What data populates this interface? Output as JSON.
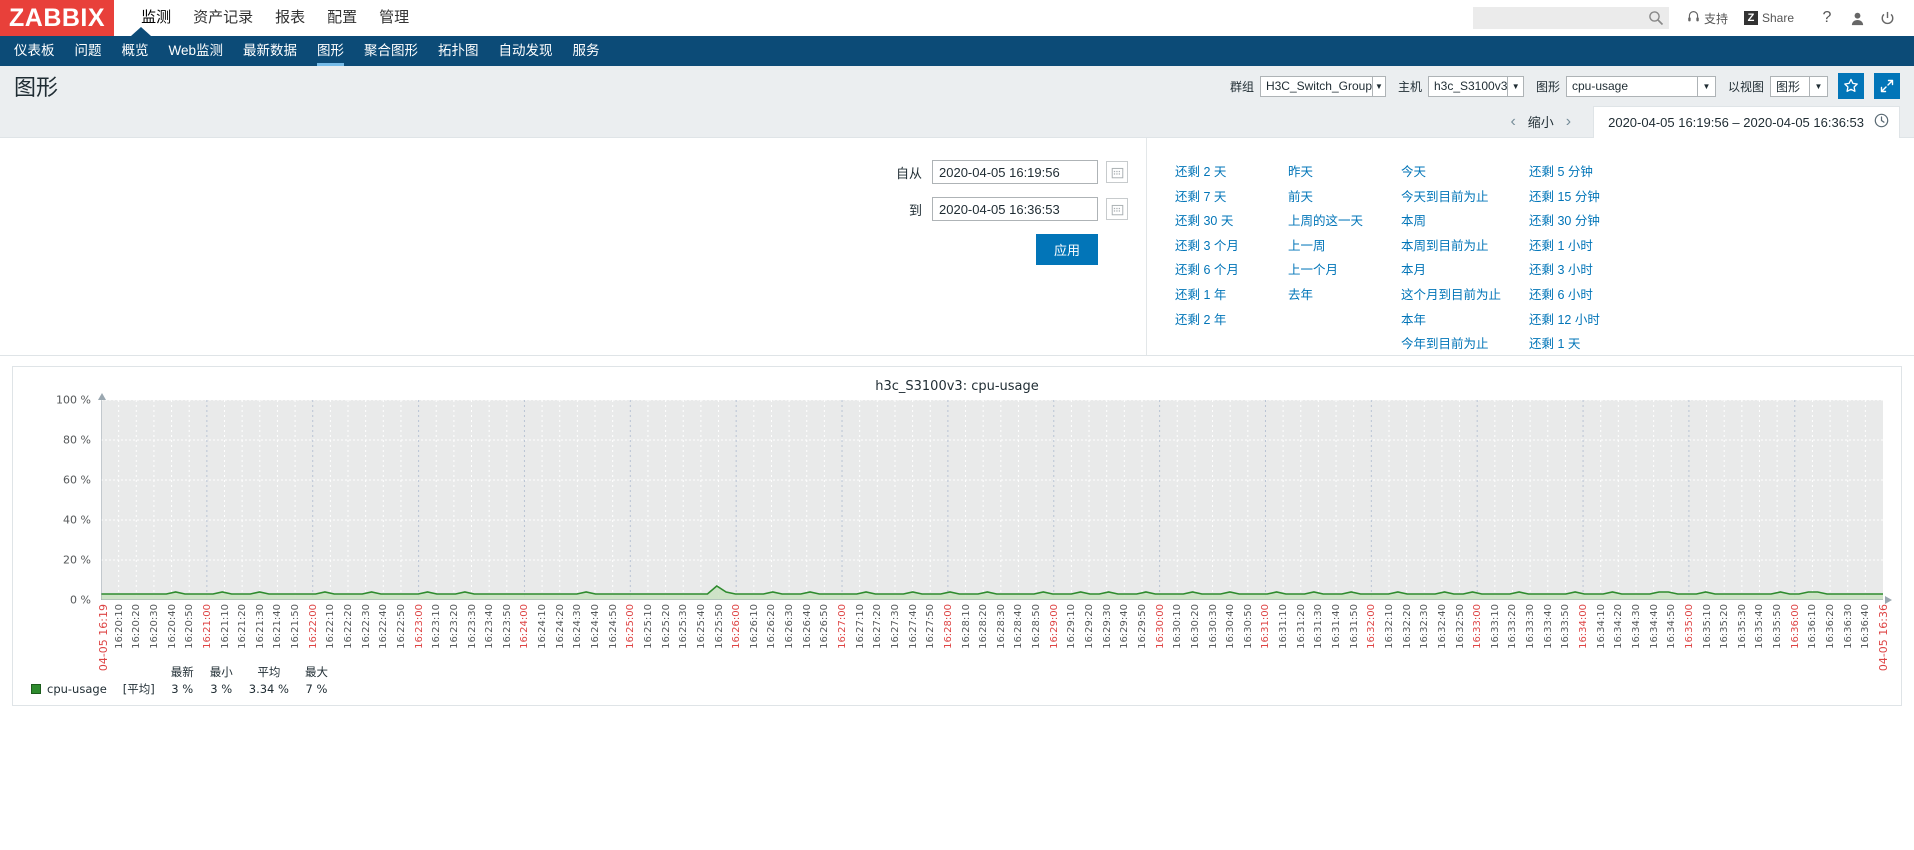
{
  "header": {
    "logo": "ZABBIX",
    "main_menu": [
      {
        "label": "监测",
        "selected": true
      },
      {
        "label": "资产记录",
        "selected": false
      },
      {
        "label": "报表",
        "selected": false
      },
      {
        "label": "配置",
        "selected": false
      },
      {
        "label": "管理",
        "selected": false
      }
    ],
    "search": {
      "value": "",
      "placeholder": ""
    },
    "search_icon": "search-icon",
    "support_label": "支持",
    "support_icon": "headset-icon",
    "share_label": "Share",
    "share_badge": "Z",
    "help_icon": "question-mark-icon",
    "user_icon": "user-icon",
    "logout_icon": "power-icon"
  },
  "sub_nav": [
    {
      "label": "仪表板",
      "active": false
    },
    {
      "label": "问题",
      "active": false
    },
    {
      "label": "概览",
      "active": false
    },
    {
      "label": "Web监测",
      "active": false
    },
    {
      "label": "最新数据",
      "active": false
    },
    {
      "label": "图形",
      "active": true
    },
    {
      "label": "聚合图形",
      "active": false
    },
    {
      "label": "拓扑图",
      "active": false
    },
    {
      "label": "自动发现",
      "active": false
    },
    {
      "label": "服务",
      "active": false
    }
  ],
  "page": {
    "title": "图形"
  },
  "filter": {
    "group_label": "群组",
    "group_value": "H3C_Switch_Group",
    "host_label": "主机",
    "host_value": "h3c_S3100v3",
    "graph_label": "图形",
    "graph_value": "cpu-usage",
    "view_label": "以视图",
    "view_value": "图形",
    "favorite_icon": "star-icon",
    "fullscreen_icon": "expand-icon"
  },
  "time_bar": {
    "prev_icon": "chevron-left-icon",
    "zoom_out_label": "缩小",
    "next_icon": "chevron-right-icon",
    "range_text": "2020-04-05 16:19:56 – 2020-04-05 16:36:53",
    "clock_icon": "clock-icon"
  },
  "time_panel": {
    "from_label": "自从",
    "from_value": "2020-04-05 16:19:56",
    "to_label": "到",
    "to_value": "2020-04-05 16:36:53",
    "calendar_icon": "calendar-icon",
    "apply_label": "应用",
    "quick_ranges": [
      [
        "还剩 2 天",
        "还剩 7 天",
        "还剩 30 天",
        "还剩 3 个月",
        "还剩 6 个月",
        "还剩 1 年",
        "还剩 2 年"
      ],
      [
        "昨天",
        "前天",
        "上周的这一天",
        "上一周",
        "上一个月",
        "去年"
      ],
      [
        "今天",
        "今天到目前为止",
        "本周",
        "本周到目前为止",
        "本月",
        "这个月到目前为止",
        "本年",
        "今年到目前为止"
      ],
      [
        "还剩 5 分钟",
        "还剩 15 分钟",
        "还剩 30 分钟",
        "还剩 1 小时",
        "还剩 3 小时",
        "还剩 6 小时",
        "还剩 12 小时",
        "还剩 1 天"
      ]
    ]
  },
  "chart_data": {
    "type": "area",
    "title": "h3c_S3100v3: cpu-usage",
    "xlabel": "",
    "ylabel": "",
    "ylim": [
      0,
      100
    ],
    "yticks": [
      0,
      20,
      40,
      60,
      80,
      100
    ],
    "ytick_labels": [
      "0 %",
      "20 %",
      "40 %",
      "60 %",
      "80 %",
      "100 %"
    ],
    "grid": true,
    "legend_position": "bottom-left",
    "series_color": "#2e8b2e",
    "fill_color": "#c9e2c1",
    "x_start": "2020-04-05 16:19:56",
    "x_end": "2020-04-05 16:36:53",
    "x_edge_labels": [
      "04-05 16:19",
      "04-05 16:36"
    ],
    "x_tick_interval_seconds": 10,
    "xtick_labels": [
      "16:20:10",
      "16:20:20",
      "16:20:30",
      "16:20:40",
      "16:20:50",
      "16:21:00",
      "16:21:10",
      "16:21:20",
      "16:21:30",
      "16:21:40",
      "16:21:50",
      "16:22:00",
      "16:22:10",
      "16:22:20",
      "16:22:30",
      "16:22:40",
      "16:22:50",
      "16:23:00",
      "16:23:10",
      "16:23:20",
      "16:23:30",
      "16:23:40",
      "16:23:50",
      "16:24:00",
      "16:24:10",
      "16:24:20",
      "16:24:30",
      "16:24:40",
      "16:24:50",
      "16:25:00",
      "16:25:10",
      "16:25:20",
      "16:25:30",
      "16:25:40",
      "16:25:50",
      "16:26:00",
      "16:26:10",
      "16:26:20",
      "16:26:30",
      "16:26:40",
      "16:26:50",
      "16:27:00",
      "16:27:10",
      "16:27:20",
      "16:27:30",
      "16:27:40",
      "16:27:50",
      "16:28:00",
      "16:28:10",
      "16:28:20",
      "16:28:30",
      "16:28:40",
      "16:28:50",
      "16:29:00",
      "16:29:10",
      "16:29:20",
      "16:29:30",
      "16:29:40",
      "16:29:50",
      "16:30:00",
      "16:30:10",
      "16:30:20",
      "16:30:30",
      "16:30:40",
      "16:30:50",
      "16:31:00",
      "16:31:10",
      "16:31:20",
      "16:31:30",
      "16:31:40",
      "16:31:50",
      "16:32:00",
      "16:32:10",
      "16:32:20",
      "16:32:30",
      "16:32:40",
      "16:32:50",
      "16:33:00",
      "16:33:10",
      "16:33:20",
      "16:33:30",
      "16:33:40",
      "16:33:50",
      "16:34:00",
      "16:34:10",
      "16:34:20",
      "16:34:30",
      "16:34:40",
      "16:34:50",
      "16:35:00",
      "16:35:10",
      "16:35:20",
      "16:35:30",
      "16:35:40",
      "16:35:50",
      "16:36:00",
      "16:36:10",
      "16:36:20",
      "16:36:30",
      "16:36:40"
    ],
    "series": [
      {
        "name": "cpu-usage",
        "values": [
          3,
          3,
          3,
          3,
          3,
          3,
          3,
          3,
          4,
          3,
          3,
          3,
          3,
          4,
          3,
          3,
          3,
          4,
          3,
          3,
          3,
          3,
          3,
          3,
          4,
          3,
          3,
          3,
          3,
          4,
          3,
          3,
          3,
          3,
          3,
          4,
          3,
          3,
          3,
          4,
          3,
          3,
          3,
          3,
          3,
          3,
          3,
          3,
          3,
          3,
          3,
          3,
          4,
          3,
          3,
          3,
          3,
          3,
          3,
          3,
          3,
          3,
          3,
          3,
          3,
          3,
          7,
          4,
          3,
          3,
          3,
          3,
          4,
          3,
          3,
          3,
          4,
          3,
          3,
          3,
          3,
          3,
          4,
          3,
          3,
          3,
          3,
          4,
          3,
          3,
          3,
          4,
          3,
          3,
          3,
          4,
          3,
          3,
          3,
          3,
          3,
          4,
          3,
          3,
          3,
          4,
          3,
          3,
          4,
          3,
          3,
          3,
          4,
          3,
          3,
          3,
          3,
          4,
          3,
          3,
          3,
          4,
          3,
          3,
          3,
          3,
          4,
          3,
          3,
          3,
          4,
          3,
          3,
          3,
          4,
          3,
          3,
          3,
          3,
          4,
          3,
          3,
          3,
          3,
          4,
          3,
          3,
          4,
          3,
          3,
          3,
          3,
          4,
          3,
          3,
          3,
          3,
          3,
          4,
          3,
          3,
          3,
          4,
          3,
          3,
          3,
          3,
          4,
          4,
          3,
          3,
          3,
          4,
          3,
          3,
          3,
          3,
          3,
          3,
          3,
          4,
          3,
          3,
          4,
          4,
          3,
          3,
          3,
          3,
          3,
          3,
          3
        ]
      }
    ]
  },
  "legend": {
    "headers": [
      "最新",
      "最小",
      "平均",
      "最大"
    ],
    "rows": [
      {
        "name": "cpu-usage",
        "aggregate": "[平均]",
        "last": "3 %",
        "min": "3 %",
        "avg": "3.34 %",
        "max": "7 %"
      }
    ]
  }
}
